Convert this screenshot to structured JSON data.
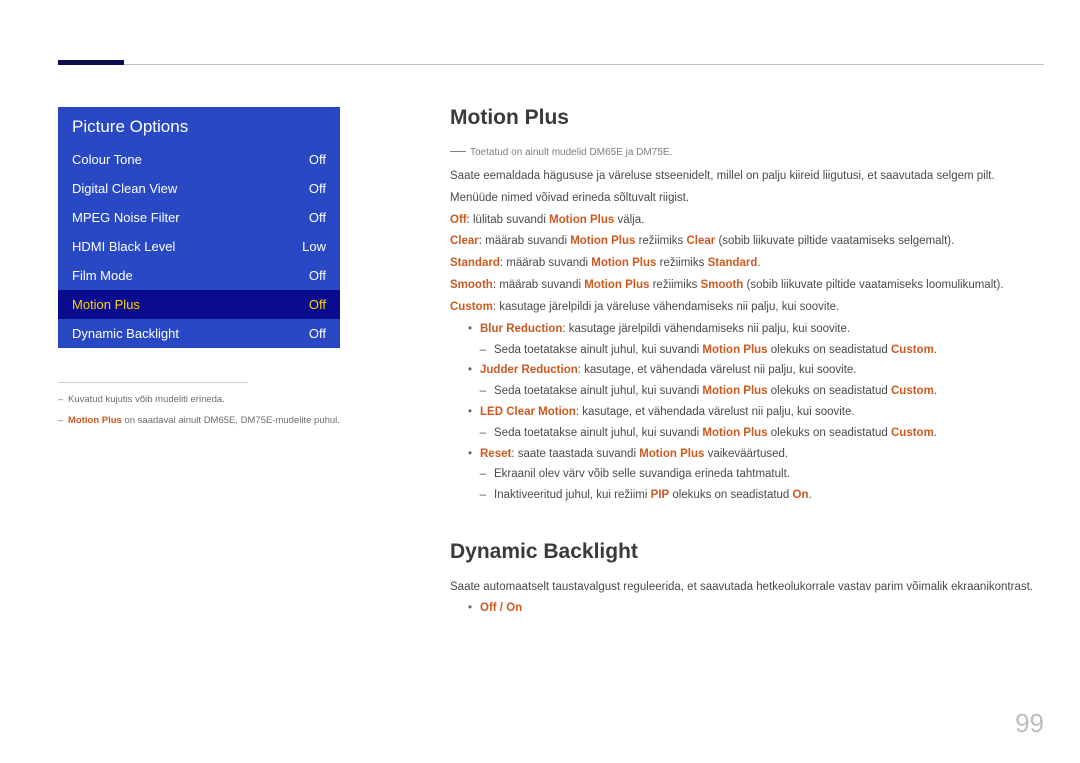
{
  "page_number": "99",
  "menu": {
    "title": "Picture Options",
    "items": [
      {
        "label": "Colour Tone",
        "value": "Off",
        "selected": false
      },
      {
        "label": "Digital Clean View",
        "value": "Off",
        "selected": false
      },
      {
        "label": "MPEG Noise Filter",
        "value": "Off",
        "selected": false
      },
      {
        "label": "HDMI Black Level",
        "value": "Low",
        "selected": false
      },
      {
        "label": "Film Mode",
        "value": "Off",
        "selected": false
      },
      {
        "label": "Motion Plus",
        "value": "Off",
        "selected": true
      },
      {
        "label": "Dynamic Backlight",
        "value": "Off",
        "selected": false
      }
    ]
  },
  "footnotes": {
    "f1_pre": "Kuvatud kujutis võib mudeliti erineda.",
    "f2_name": "Motion Plus",
    "f2_rest": " on saadaval ainult DM65E, DM75E-mudelite puhul."
  },
  "section1": {
    "heading": "Motion Plus",
    "support": "Toetatud on ainult mudelid DM65E ja DM75E.",
    "intro1": "Saate eemaldada hägususe ja väreluse stseenidelt, millel on palju kiireid liigutusi, et saavutada selgem pilt.",
    "intro2": "Menüüde nimed võivad erineda sõltuvalt riigist.",
    "off_pre": "Off",
    "off_rest": ": lülitab suvandi ",
    "off_name": "Motion Plus",
    "off_tail": " välja.",
    "clear_pre": "Clear",
    "clear_mid": ": määrab suvandi ",
    "clear_name": "Motion Plus",
    "clear_mode_pre": " režiimiks ",
    "clear_mode": "Clear",
    "clear_tail": " (sobib liikuvate piltide vaatamiseks selgemalt).",
    "standard_pre": "Standard",
    "standard_mid": ": määrab suvandi ",
    "standard_name": "Motion Plus",
    "standard_mode_pre": " režiimiks ",
    "standard_mode": "Standard",
    "standard_tail": ".",
    "smooth_pre": "Smooth",
    "smooth_mid": ": määrab suvandi ",
    "smooth_name": "Motion Plus",
    "smooth_mode_pre": " režiimiks ",
    "smooth_mode": "Smooth",
    "smooth_tail": " (sobib liikuvate piltide vaatamiseks loomulikumalt).",
    "custom_pre": "Custom",
    "custom_rest": ": kasutage järelpildi ja väreluse vähendamiseks nii palju, kui soovite.",
    "blur_pre": "Blur Reduction",
    "blur_rest": ": kasutage järelpildi vähendamiseks nii palju, kui soovite.",
    "blur_sub_pre": "Seda toetatakse ainult juhul, kui suvandi ",
    "blur_sub_name": "Motion Plus",
    "blur_sub_mid": " olekuks on seadistatud ",
    "blur_sub_val": "Custom",
    "blur_sub_tail": ".",
    "judder_pre": "Judder Reduction",
    "judder_rest": ": kasutage, et vähendada värelust nii palju, kui soovite.",
    "led_pre": "LED Clear Motion",
    "led_rest": ": kasutage, et vähendada värelust nii palju, kui soovite.",
    "reset_pre": "Reset",
    "reset_mid": ": saate taastada suvandi ",
    "reset_name": "Motion Plus",
    "reset_tail": " vaikeväärtused.",
    "reset_sub1": "Ekraanil olev värv võib selle suvandiga erineda tahtmatult.",
    "reset_sub2_pre": "Inaktiveeritud juhul, kui režiimi ",
    "reset_sub2_name": "PIP",
    "reset_sub2_mid": " olekuks on seadistatud ",
    "reset_sub2_val": "On",
    "reset_sub2_tail": "."
  },
  "section2": {
    "heading": "Dynamic Backlight",
    "intro": "Saate automaatselt taustavalgust reguleerida, et saavutada hetkeolukorrale vastav parim võimalik ekraanikontrast.",
    "opt": "Off / On"
  }
}
